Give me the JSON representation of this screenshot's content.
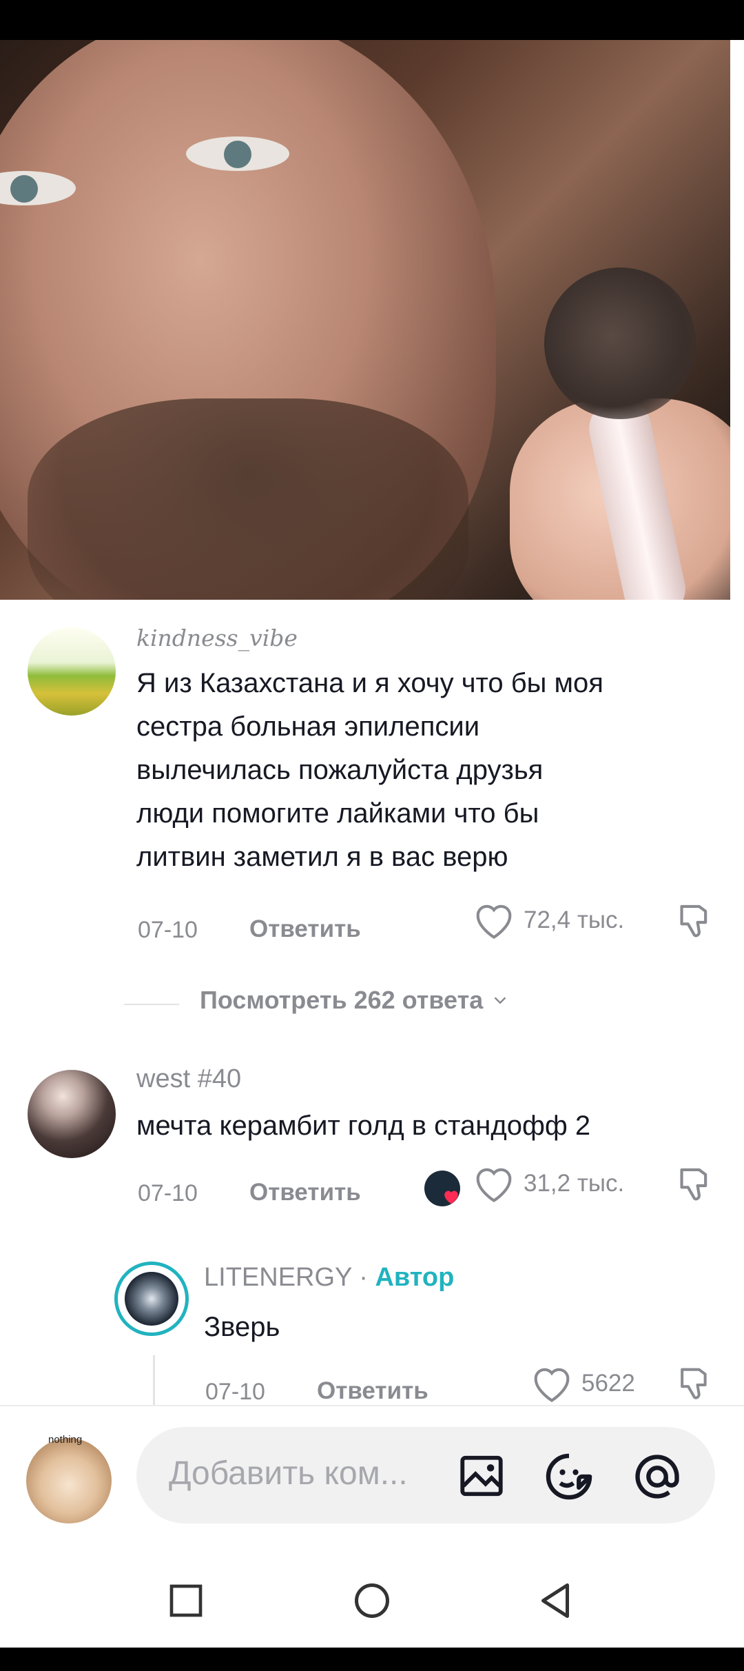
{
  "comments": [
    {
      "username": "kindness_vibe",
      "text_lines": [
        "Я из Казахстана и я хочу что бы моя",
        "сестра больная эпилепсии",
        "вылечилась пожалуйста друзья",
        "люди помогите лайками что бы",
        "литвин заметил я в вас верю"
      ],
      "date": "07-10",
      "reply_label": "Ответить",
      "likes": "72,4 тыс."
    },
    {
      "username": "west #40",
      "text_lines": [
        "мечта керамбит голд в стандофф 2"
      ],
      "date": "07-10",
      "reply_label": "Ответить",
      "likes": "31,2 тыс."
    }
  ],
  "view_replies": "Посмотреть 262 ответа",
  "author_reply": {
    "username": "LITENERGY",
    "separator": " · ",
    "badge": "Автор",
    "text": "Зверь",
    "date": "07-10",
    "reply_label": "Ответить",
    "likes": "5622"
  },
  "input": {
    "placeholder": "Добавить ком...",
    "avatar_label": "nothing"
  },
  "colors": {
    "author_badge": "#21b3bf",
    "text": "#161823",
    "muted": "#8a8b91",
    "like_heart_red": "#fe2c55"
  },
  "icons": [
    "heart-icon",
    "dislike-icon",
    "chevron-down-icon",
    "image-icon",
    "emoji-icon",
    "mention-icon",
    "recent-apps-icon",
    "home-icon",
    "back-icon"
  ]
}
